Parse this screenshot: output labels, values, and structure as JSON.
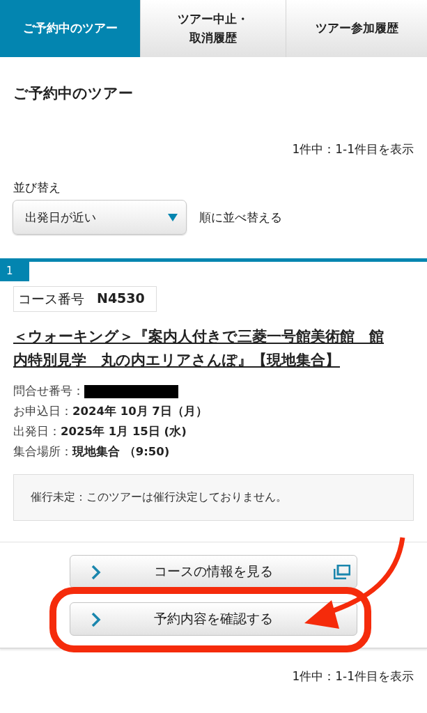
{
  "tabs": [
    {
      "label": "ご予約中のツアー",
      "selected": true
    },
    {
      "label": "ツアー中止・取消履歴",
      "selected": false
    },
    {
      "label": "ツアー参加履歴",
      "selected": false
    }
  ],
  "heading": "ご予約中のツアー",
  "count_top": "1件中：1-1件目を表示",
  "sort": {
    "label": "並び替え",
    "value": "出発日が近い",
    "suffix": "順に並べ替える"
  },
  "tours": [
    {
      "number": "1",
      "course_label": "コース番号",
      "course_code": "N4530",
      "title": "＜ウォーキング＞『案内人付きで三菱一号館美術館　館内特別見学　丸の内エリアさんぽ』【現地集合】",
      "details": [
        {
          "kind": "redacted",
          "label": "問合せ番号："
        },
        {
          "kind": "text",
          "label": "お申込日：",
          "value": "2024年 10月 7日（月）"
        },
        {
          "kind": "text",
          "label": "出発日：",
          "value": "2025年 1月 15日 (水)"
        },
        {
          "kind": "text",
          "label": "集合場所：",
          "value": " 現地集合 （9:50)"
        }
      ],
      "notice": "催行未定：このツアーは催行決定しておりません。",
      "buttons": [
        {
          "kind": "external",
          "label": "コースの情報を見る"
        },
        {
          "kind": "plain",
          "label": "予約内容を確認する"
        }
      ]
    }
  ],
  "count_bottom": "1件中：1-1件目を表示"
}
